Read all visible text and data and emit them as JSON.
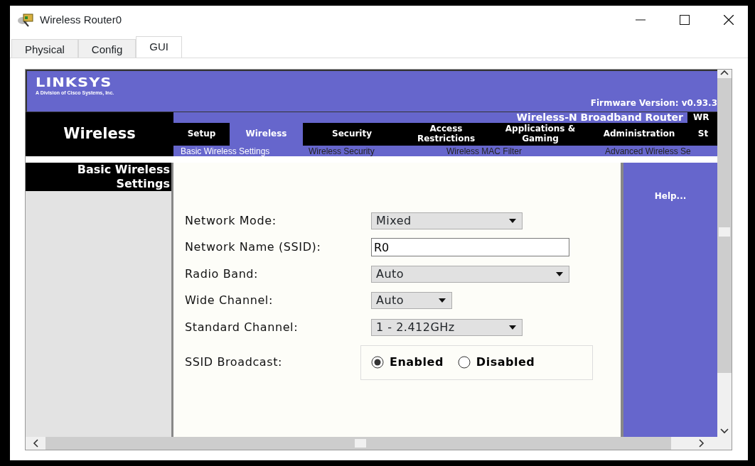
{
  "window": {
    "title": "Wireless Router0"
  },
  "tabs": [
    {
      "label": "Physical",
      "selected": false
    },
    {
      "label": "Config",
      "selected": false
    },
    {
      "label": "GUI",
      "selected": true
    }
  ],
  "router": {
    "brand": "LINKSYS",
    "tagline": "A Division of Cisco Systems, Inc.",
    "firmware": "Firmware Version: v0.93.3",
    "product": "Wireless-N Broadband Router",
    "model": "WR",
    "section": "Wireless",
    "nav": [
      {
        "label": "Setup",
        "selected": false
      },
      {
        "label": "Wireless",
        "selected": true
      },
      {
        "label": "Security",
        "selected": false
      },
      {
        "label": "Access Restrictions",
        "selected": false
      },
      {
        "label": "Applications & Gaming",
        "selected": false
      },
      {
        "label": "Administration",
        "selected": false
      },
      {
        "label": "St",
        "selected": false
      }
    ],
    "subnav": [
      {
        "label": "Basic Wireless Settings",
        "selected": true
      },
      {
        "label": "Wireless Security",
        "selected": false
      },
      {
        "label": "Wireless MAC Filter",
        "selected": false
      },
      {
        "label": "Advanced Wireless Se",
        "selected": false
      }
    ],
    "page_title": "Basic Wireless Settings",
    "help": "Help..."
  },
  "form": [
    {
      "kind": "select",
      "label": "Network Mode:",
      "value": "Mixed"
    },
    {
      "kind": "text",
      "label": "Network Name (SSID):",
      "value": "R0"
    },
    {
      "kind": "select",
      "label": "Radio Band:",
      "value": "Auto"
    },
    {
      "kind": "select",
      "label": "Wide Channel:",
      "value": "Auto"
    },
    {
      "kind": "select",
      "label": "Standard Channel:",
      "value": "1 - 2.412GHz"
    },
    {
      "kind": "radio",
      "label": "SSID Broadcast:",
      "options": [
        {
          "label": "Enabled",
          "selected": true
        },
        {
          "label": "Disabled",
          "selected": false
        }
      ]
    }
  ]
}
